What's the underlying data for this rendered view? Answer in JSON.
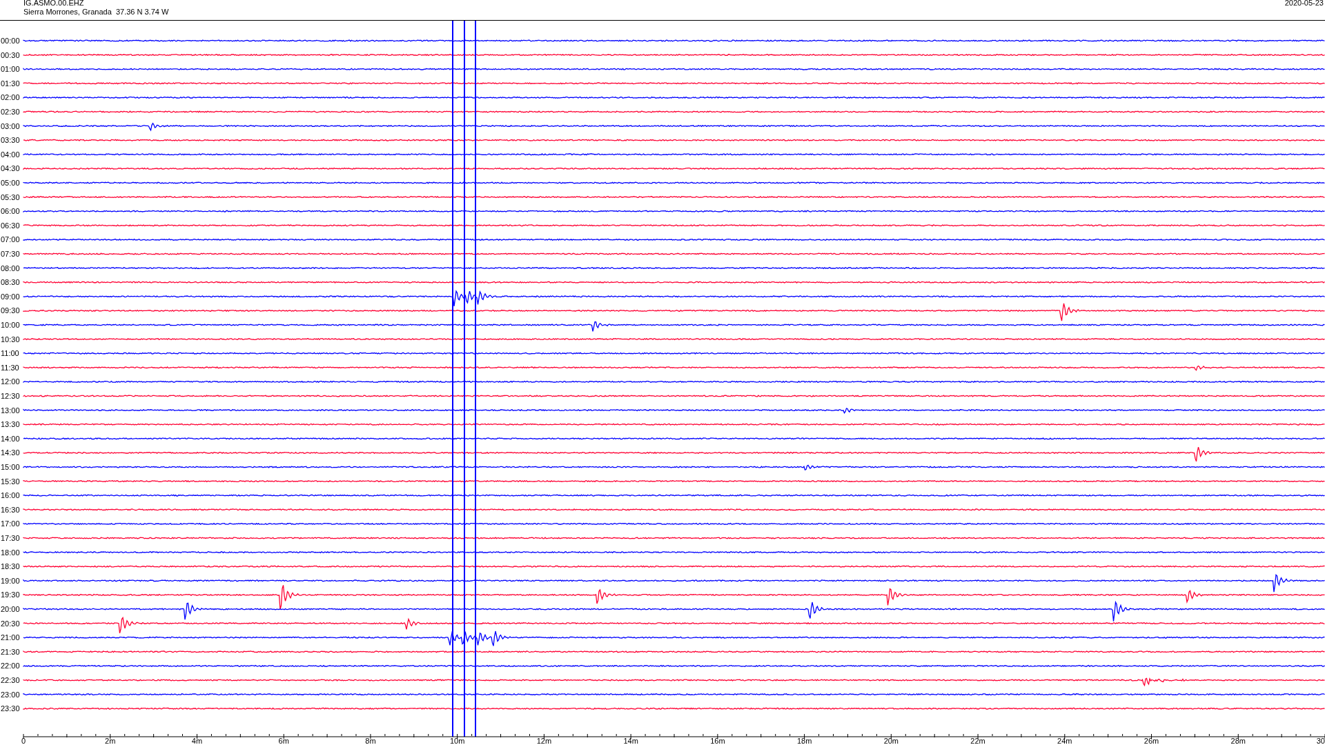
{
  "header": {
    "station": "IG.ASMO.00.EHZ",
    "location": "Sierra Morrones, Granada  37.36 N 3.74 W",
    "date": "2020-05-23"
  },
  "traces": [
    {
      "label": "00:00",
      "color": "#0000ff"
    },
    {
      "label": "00:30",
      "color": "#ff0033"
    },
    {
      "label": "01:00",
      "color": "#0000ff"
    },
    {
      "label": "01:30",
      "color": "#ff0033"
    },
    {
      "label": "02:00",
      "color": "#0000ff"
    },
    {
      "label": "02:30",
      "color": "#ff0033"
    },
    {
      "label": "03:00",
      "color": "#0000ff"
    },
    {
      "label": "03:30",
      "color": "#ff0033"
    },
    {
      "label": "04:00",
      "color": "#0000ff"
    },
    {
      "label": "04:30",
      "color": "#ff0033"
    },
    {
      "label": "05:00",
      "color": "#0000ff"
    },
    {
      "label": "05:30",
      "color": "#ff0033"
    },
    {
      "label": "06:00",
      "color": "#0000ff"
    },
    {
      "label": "06:30",
      "color": "#ff0033"
    },
    {
      "label": "07:00",
      "color": "#0000ff"
    },
    {
      "label": "07:30",
      "color": "#ff0033"
    },
    {
      "label": "08:00",
      "color": "#0000ff"
    },
    {
      "label": "08:30",
      "color": "#ff0033"
    },
    {
      "label": "09:00",
      "color": "#0000ff"
    },
    {
      "label": "09:30",
      "color": "#ff0033"
    },
    {
      "label": "10:00",
      "color": "#0000ff"
    },
    {
      "label": "10:30",
      "color": "#ff0033"
    },
    {
      "label": "11:00",
      "color": "#0000ff"
    },
    {
      "label": "11:30",
      "color": "#ff0033"
    },
    {
      "label": "12:00",
      "color": "#0000ff"
    },
    {
      "label": "12:30",
      "color": "#ff0033"
    },
    {
      "label": "13:00",
      "color": "#0000ff"
    },
    {
      "label": "13:30",
      "color": "#ff0033"
    },
    {
      "label": "14:00",
      "color": "#0000ff"
    },
    {
      "label": "14:30",
      "color": "#ff0033"
    },
    {
      "label": "15:00",
      "color": "#0000ff"
    },
    {
      "label": "15:30",
      "color": "#ff0033"
    },
    {
      "label": "16:00",
      "color": "#0000ff"
    },
    {
      "label": "16:30",
      "color": "#ff0033"
    },
    {
      "label": "17:00",
      "color": "#0000ff"
    },
    {
      "label": "17:30",
      "color": "#ff0033"
    },
    {
      "label": "18:00",
      "color": "#0000ff"
    },
    {
      "label": "18:30",
      "color": "#ff0033"
    },
    {
      "label": "19:00",
      "color": "#0000ff"
    },
    {
      "label": "19:30",
      "color": "#ff0033"
    },
    {
      "label": "20:00",
      "color": "#0000ff"
    },
    {
      "label": "20:30",
      "color": "#ff0033"
    },
    {
      "label": "21:00",
      "color": "#0000ff"
    },
    {
      "label": "21:30",
      "color": "#ff0033"
    },
    {
      "label": "22:00",
      "color": "#0000ff"
    },
    {
      "label": "22:30",
      "color": "#ff0033"
    },
    {
      "label": "23:00",
      "color": "#0000ff"
    },
    {
      "label": "23:30",
      "color": "#ff0033"
    }
  ],
  "x_axis": {
    "tick_labels": [
      "0",
      "2m",
      "4m",
      "6m",
      "8m",
      "10m",
      "12m",
      "14m",
      "16m",
      "18m",
      "20m",
      "22m",
      "24m",
      "26m",
      "28m",
      "30"
    ]
  }
}
